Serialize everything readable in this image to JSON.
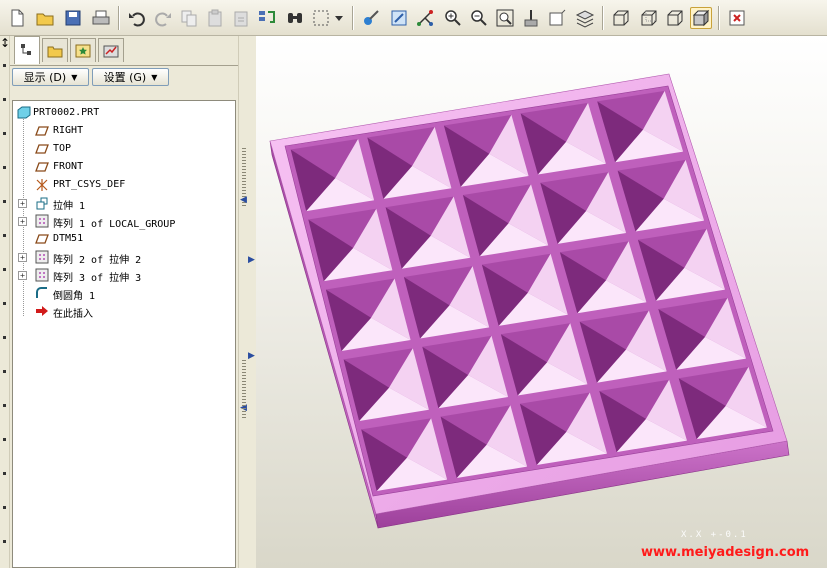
{
  "toolbar": {
    "icons": [
      "new-file-icon",
      "open-folder-icon",
      "save-icon",
      "print-icon",
      "undo-icon",
      "redo-icon",
      "copy-icon",
      "paste-icon",
      "paste-special-icon",
      "regenerate-icon",
      "find-icon",
      "select-box-icon",
      "dropdown-arrow-icon",
      "appearance-icon",
      "view-repaint-icon",
      "spin-center-icon",
      "zoom-in-icon",
      "zoom-out-icon",
      "refit-icon",
      "orient-icon",
      "saved-views-icon",
      "layers-icon",
      "wireframe-icon",
      "hidden-line-icon",
      "no-hidden-icon",
      "shading-icon",
      "close-window-icon"
    ]
  },
  "navigator": {
    "tabs": [
      "model-tree-tab",
      "folder-browser-tab",
      "favorites-tab",
      "connections-tab"
    ],
    "show_label": "显示 (D)",
    "settings_label": "设置 (G)"
  },
  "model_tree": {
    "root": "PRT0002.PRT",
    "items": [
      {
        "label": "RIGHT",
        "icon": "datum-plane-icon",
        "expandable": false
      },
      {
        "label": "TOP",
        "icon": "datum-plane-icon",
        "expandable": false
      },
      {
        "label": "FRONT",
        "icon": "datum-plane-icon",
        "expandable": false
      },
      {
        "label": "PRT_CSYS_DEF",
        "icon": "csys-icon",
        "expandable": false
      },
      {
        "label": "拉伸 1",
        "icon": "extrude-icon",
        "expandable": true
      },
      {
        "label": "阵列 1 of LOCAL_GROUP",
        "icon": "pattern-icon",
        "expandable": true
      },
      {
        "label": "DTM51",
        "icon": "datum-plane-icon",
        "expandable": false
      },
      {
        "label": "阵列 2 of 拉伸 2",
        "icon": "pattern-icon",
        "expandable": true
      },
      {
        "label": "阵列 3 of 拉伸 3",
        "icon": "pattern-icon",
        "expandable": true
      },
      {
        "label": "倒圆角 1",
        "icon": "round-icon",
        "expandable": false
      },
      {
        "label": "在此插入",
        "icon": "insert-here-arrow-icon",
        "expandable": false
      }
    ]
  },
  "viewport": {
    "coord_readout": "X.X  +-0.1",
    "watermark": "www.meiyadesign.com",
    "model_color": "#d97fd6",
    "grid_rows": 5,
    "grid_cols": 5
  }
}
